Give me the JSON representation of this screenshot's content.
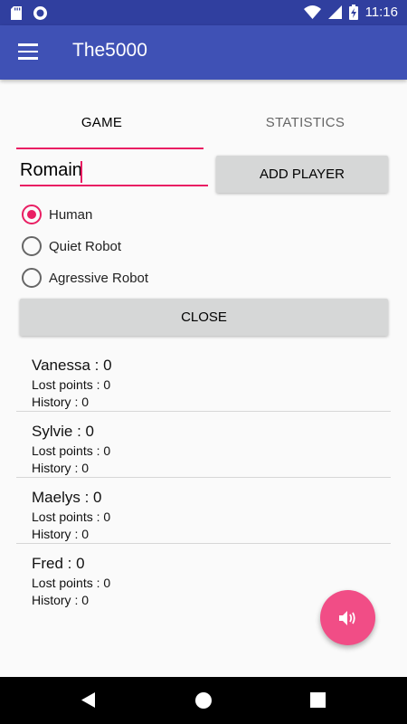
{
  "status_bar": {
    "time": "11:16",
    "icons": [
      "sd-card-icon",
      "notification-circle-icon",
      "wifi-icon",
      "signal-icon",
      "battery-charging-icon"
    ]
  },
  "app_bar": {
    "title": "The5000",
    "menu_icon": "hamburger-menu-icon"
  },
  "tabs": [
    {
      "label": "GAME",
      "selected": true
    },
    {
      "label": "STATISTICS",
      "selected": false
    }
  ],
  "name_input": {
    "value": "Romain"
  },
  "add_player_button": "ADD PLAYER",
  "player_types": [
    {
      "label": "Human",
      "checked": true
    },
    {
      "label": "Quiet Robot",
      "checked": false
    },
    {
      "label": "Agressive Robot",
      "checked": false
    }
  ],
  "close_button": "CLOSE",
  "players": [
    {
      "name": "Vanessa : 0",
      "lost": "Lost points : 0",
      "history": "History : 0"
    },
    {
      "name": "Sylvie : 0",
      "lost": "Lost points : 0",
      "history": "History : 0"
    },
    {
      "name": "Maelys : 0",
      "lost": "Lost points : 0",
      "history": "History : 0"
    },
    {
      "name": "Fred : 0",
      "lost": "Lost points : 0",
      "history": "History : 0"
    }
  ],
  "fab": {
    "icon": "speaker-icon"
  },
  "nav_bar": {
    "icons": [
      "back-icon",
      "home-icon",
      "recents-icon"
    ]
  },
  "colors": {
    "primary": "#3f51b5",
    "primary_dark": "#303f9f",
    "accent": "#e91e63",
    "fab": "#f14d86"
  }
}
